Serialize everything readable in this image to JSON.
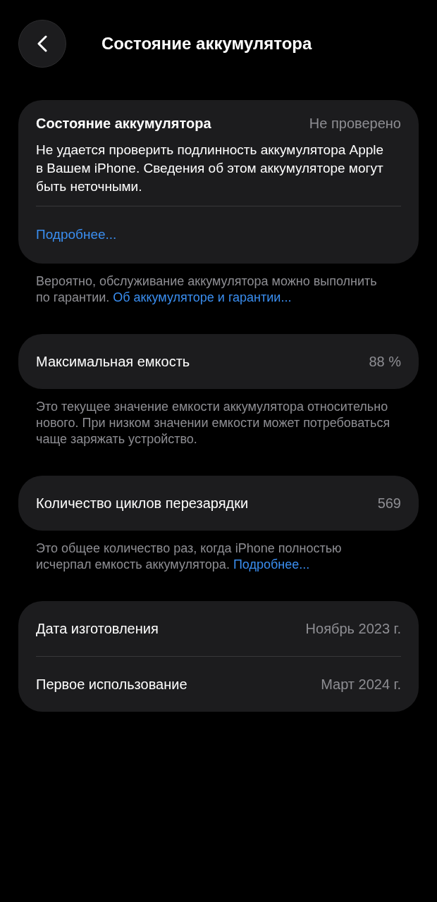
{
  "header": {
    "title": "Состояние аккумулятора"
  },
  "sections": [
    {
      "rows": [
        {
          "kind": "status",
          "label": "Состояние аккумулятора",
          "value": "Не проверено",
          "description": "Не удается проверить подлинность аккумулятора Apple в Вашем iPhone. Сведения об этом аккумуляторе могут быть неточными.",
          "link": "Подробнее..."
        }
      ],
      "footer": [
        {
          "kind": "text",
          "text": "Вероятно, обслуживание аккумулятора можно выполнить по гарантии."
        },
        {
          "kind": "link",
          "text": "Об аккумуляторе и гарантии..."
        }
      ]
    },
    {
      "rows": [
        {
          "kind": "value",
          "label": "Максимальная емкость",
          "value": "88 %"
        }
      ],
      "footer": [
        {
          "kind": "text",
          "text": "Это текущее значение емкости аккумулятора относительно нового. При низком значении емкости может потребоваться чаще заряжать устройство."
        }
      ]
    },
    {
      "rows": [
        {
          "kind": "value",
          "label": "Количество циклов перезарядки",
          "value": "569"
        }
      ],
      "footer": [
        {
          "kind": "text",
          "text": "Это общее количество раз, когда iPhone полностью исчерпал емкость аккумулятора."
        },
        {
          "kind": "link",
          "text": "Подробнее..."
        }
      ]
    },
    {
      "rows": [
        {
          "kind": "value",
          "label": "Дата изготовления",
          "value": "Ноябрь 2023 г."
        },
        {
          "kind": "value",
          "label": "Первое использование",
          "value": "Март 2024 г."
        }
      ]
    }
  ]
}
